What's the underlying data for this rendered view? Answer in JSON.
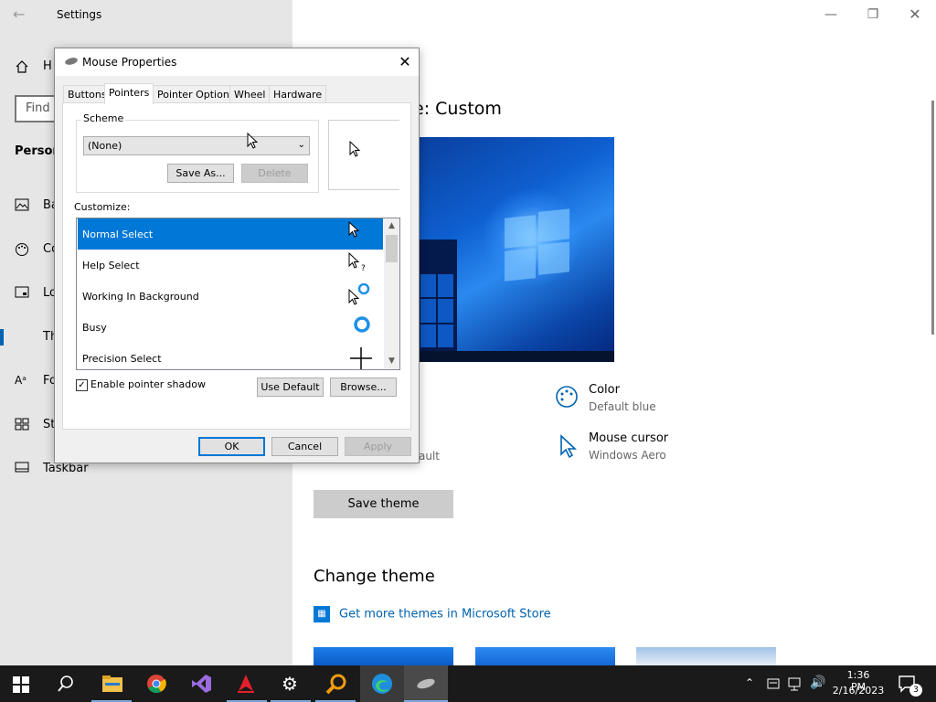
{
  "settings": {
    "title": "Settings",
    "search_placeholder": "Find",
    "section": "Person",
    "nav": [
      {
        "label": "H",
        "icon": "home-icon"
      },
      {
        "label": "Ba",
        "icon": "picture-icon"
      },
      {
        "label": "Co",
        "icon": "palette-icon"
      },
      {
        "label": "Lo",
        "icon": "lockscreen-icon"
      },
      {
        "label": "Th",
        "icon": "brush-icon"
      },
      {
        "label": "Fo",
        "icon": "font-icon"
      },
      {
        "label": "St",
        "icon": "start-icon"
      },
      {
        "label": "Taskbar",
        "icon": "taskbar-icon"
      }
    ],
    "heading": "e: Custom",
    "props": [
      {
        "name": "Color",
        "value": "Default blue"
      },
      {
        "name": "Mouse cursor",
        "value": "Windows Aero"
      }
    ],
    "partial_text": "ault",
    "save_theme": "Save theme",
    "change_theme": "Change theme",
    "store_link": "Get more themes in Microsoft Store",
    "accent": "#0063b1"
  },
  "dialog": {
    "title": "Mouse Properties",
    "tabs": [
      "Buttons",
      "Pointers",
      "Pointer Options",
      "Wheel",
      "Hardware"
    ],
    "active_tab": "Pointers",
    "scheme_label": "Scheme",
    "scheme_value": "(None)",
    "save_as": "Save As...",
    "delete": "Delete",
    "customize_label": "Customize:",
    "pointers": [
      {
        "name": "Normal Select",
        "selected": true
      },
      {
        "name": "Help Select",
        "selected": false
      },
      {
        "name": "Working In Background",
        "selected": false
      },
      {
        "name": "Busy",
        "selected": false
      },
      {
        "name": "Precision Select",
        "selected": false
      }
    ],
    "enable_shadow": "Enable pointer shadow",
    "shadow_checked": true,
    "use_default": "Use Default",
    "browse": "Browse...",
    "ok": "OK",
    "cancel": "Cancel",
    "apply": "Apply"
  },
  "taskbar": {
    "time": "1:36 PM",
    "date": "2/16/2023",
    "notif_count": "3",
    "apps": [
      "start-icon",
      "search-icon",
      "file-explorer-icon",
      "chrome-icon",
      "visual-studio-icon",
      "app-red-icon",
      "settings-icon",
      "magnifier-icon",
      "edge-icon",
      "mouse-icon"
    ]
  }
}
